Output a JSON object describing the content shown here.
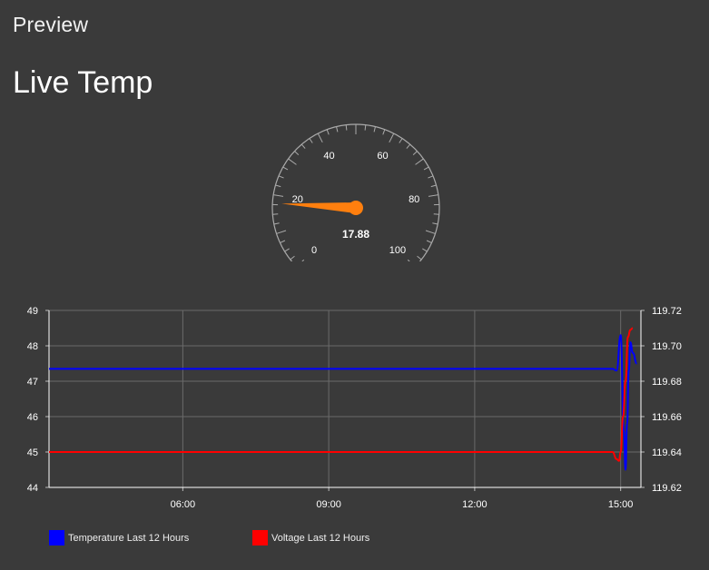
{
  "page": {
    "preview_label": "Preview",
    "title": "Live Temp"
  },
  "gauge": {
    "min": 0,
    "max": 100,
    "value": 17.88,
    "value_label": "17.88",
    "tick_labels": [
      "0",
      "20",
      "40",
      "60",
      "80",
      "100"
    ],
    "tick_values": [
      0,
      20,
      40,
      60,
      80,
      100
    ],
    "needle_color": "#ff7f0e",
    "dial_color": "#aaaaaa"
  },
  "chart_data": {
    "type": "line",
    "x_tick_labels": [
      "06:00",
      "09:00",
      "12:00",
      "15:00"
    ],
    "x_ticks": [
      "06:00",
      "09:00",
      "12:00",
      "15:00"
    ],
    "xlim": [
      "03:15",
      "15:25"
    ],
    "y_left": {
      "lim": [
        44,
        49
      ],
      "ticks": [
        "44",
        "45",
        "46",
        "47",
        "48",
        "49"
      ]
    },
    "y_right": {
      "lim": [
        119.62,
        119.72
      ],
      "ticks": [
        "119.62",
        "119.64",
        "119.66",
        "119.68",
        "119.70",
        "119.72"
      ]
    },
    "grid": true,
    "legend_placement": "bottom-left",
    "series": [
      {
        "name": "Temperature Last 12 Hours",
        "axis": "left",
        "color": "#0000ff",
        "x": [
          "03:15",
          "14:50",
          "14:55",
          "15:00",
          "15:04",
          "15:06",
          "15:08",
          "15:10",
          "15:12",
          "15:15",
          "15:20"
        ],
        "values": [
          47.35,
          47.35,
          47.3,
          48.3,
          45.6,
          44.5,
          45.8,
          47.3,
          48.1,
          47.8,
          47.5
        ]
      },
      {
        "name": "Voltage Last 12 Hours",
        "axis": "right",
        "color": "#ff0000",
        "x": [
          "03:15",
          "14:50",
          "14:55",
          "14:58",
          "15:00",
          "15:03",
          "15:06",
          "15:09",
          "15:12",
          "15:15"
        ],
        "values": [
          119.64,
          119.64,
          119.636,
          119.635,
          119.64,
          119.66,
          119.68,
          119.705,
          119.709,
          119.71
        ]
      }
    ]
  },
  "legend": [
    {
      "label": "Temperature Last 12 Hours",
      "color": "#0000ff"
    },
    {
      "label": "Voltage Last 12 Hours",
      "color": "#ff0000"
    }
  ]
}
